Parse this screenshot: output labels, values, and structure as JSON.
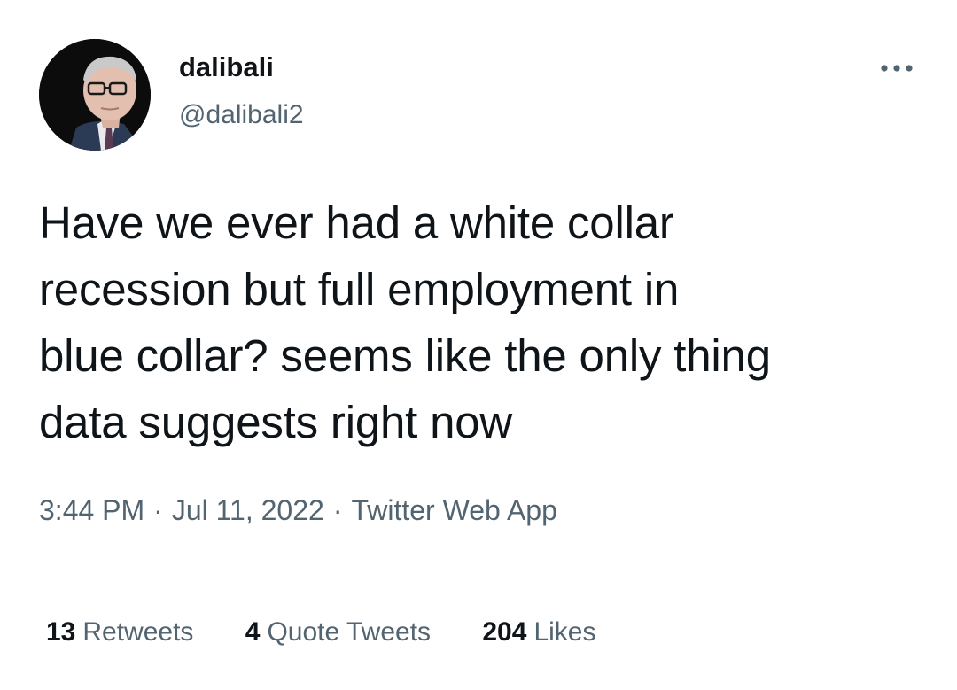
{
  "author": {
    "display_name": "dalibali",
    "handle": "@dalibali2",
    "avatar_icon": "profile-photo"
  },
  "more_icon": "ellipsis-horizontal-icon",
  "tweet": {
    "text_lines": [
      "Have we ever had a white collar",
      "recession but full employment in",
      "blue collar? seems like the only thing",
      "data suggests right now"
    ]
  },
  "meta": {
    "time": "3:44 PM",
    "separator": "·",
    "date": "Jul 11, 2022",
    "source": "Twitter Web App"
  },
  "stats": {
    "retweets_count": "13",
    "retweets_label": "Retweets",
    "quotes_count": "4",
    "quotes_label": "Quote Tweets",
    "likes_count": "204",
    "likes_label": "Likes"
  },
  "colors": {
    "primary_text": "#0f1419",
    "secondary_text": "#536471",
    "divider": "#e6ecf0",
    "background": "#ffffff"
  }
}
